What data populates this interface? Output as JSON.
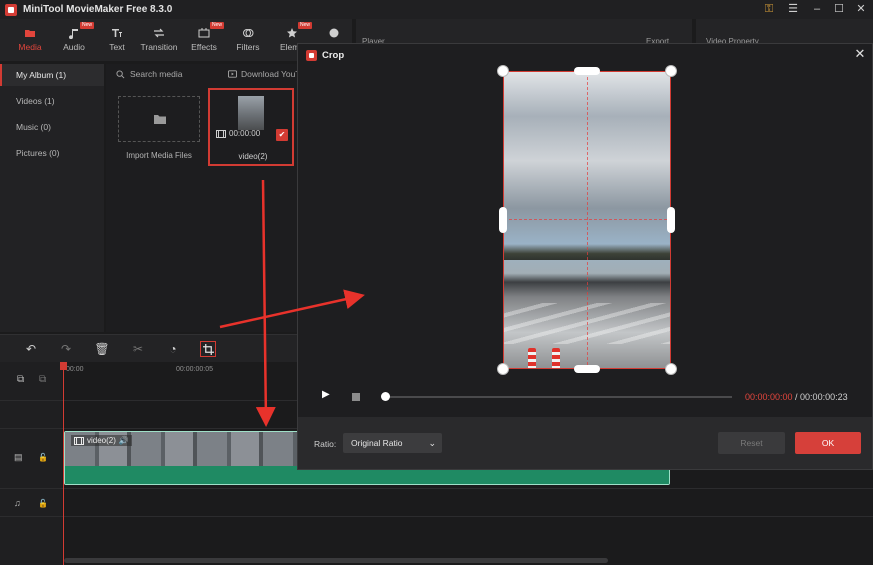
{
  "app": {
    "title": "MiniTool MovieMaker Free 8.3.0"
  },
  "toolbar": {
    "items": [
      {
        "label": "Media",
        "new": ""
      },
      {
        "label": "Audio",
        "new": "New"
      },
      {
        "label": "Text",
        "new": ""
      },
      {
        "label": "Transition",
        "new": ""
      },
      {
        "label": "Effects",
        "new": "New"
      },
      {
        "label": "Filters",
        "new": ""
      },
      {
        "label": "Eleme",
        "new": "New"
      }
    ]
  },
  "library": {
    "items": [
      "My Album (1)",
      "Videos (1)",
      "Music (0)",
      "Pictures (0)"
    ],
    "search_label": "Search media",
    "download_label": "Download YouT",
    "import_label": "Import Media Files",
    "video": {
      "name": "video(2)",
      "duration": "00:00:00"
    }
  },
  "panels": {
    "player": "Player",
    "export": "Export",
    "property": "Video Property"
  },
  "timeline": {
    "ruler": [
      "00:00",
      "00:00:00:05"
    ],
    "clip_label": "video(2)"
  },
  "crop_dialog": {
    "title": "Crop",
    "current_time": "00:00:00:00",
    "total_time": " / 00:00:00:23",
    "ratio_label": "Ratio:",
    "ratio_value": "Original Ratio",
    "reset_label": "Reset",
    "ok_label": "OK"
  },
  "colors": {
    "accent": "#d23b33",
    "clip_border": "#9fe0c8",
    "audio_wave": "#1f8a63"
  }
}
